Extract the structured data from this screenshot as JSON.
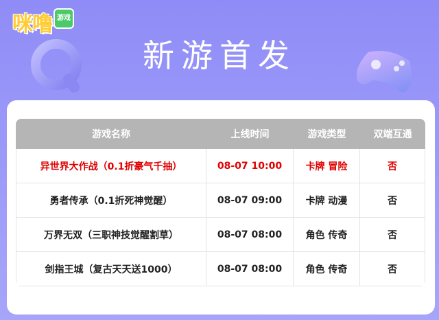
{
  "brand": {
    "logo_text": "咪噜",
    "badge_text": "游戏"
  },
  "hero": {
    "title": "新游首发"
  },
  "table": {
    "headers": [
      "游戏名称",
      "上线时间",
      "游戏类型",
      "双端互通"
    ],
    "rows": [
      {
        "name": "异世界大作战（0.1折豪气千抽）",
        "time": "08-07 10:00",
        "type": "卡牌 冒险",
        "cross": "否",
        "highlight": true
      },
      {
        "name": "勇者传承（0.1折死神觉醒）",
        "time": "08-07 09:00",
        "type": "卡牌 动漫",
        "cross": "否",
        "highlight": false
      },
      {
        "name": "万界无双（三职神技觉醒割草）",
        "time": "08-07 08:00",
        "type": "角色 传奇",
        "cross": "否",
        "highlight": false
      },
      {
        "name": "剑指王城（复古天天送1000）",
        "time": "08-07 08:00",
        "type": "角色 传奇",
        "cross": "否",
        "highlight": false
      }
    ]
  },
  "colors": {
    "highlight": "#e00000",
    "header_bg": "#b5b5b5",
    "background": "#9a98f8"
  }
}
